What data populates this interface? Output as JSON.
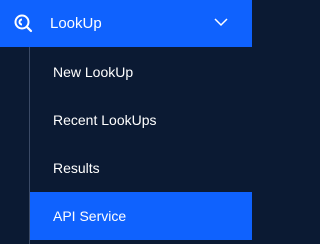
{
  "header": {
    "title": "LookUp",
    "icon": "lookup-icon",
    "toggle_icon": "chevron-down-icon",
    "expanded": true
  },
  "submenu": {
    "items": [
      {
        "label": "New LookUp",
        "active": false
      },
      {
        "label": "Recent LookUps",
        "active": false
      },
      {
        "label": "Results",
        "active": false
      },
      {
        "label": "API Service",
        "active": true
      }
    ]
  },
  "colors": {
    "accent": "#0f62fe",
    "background": "#0b1a33",
    "divider": "#3b4a66",
    "text": "#ffffff"
  }
}
